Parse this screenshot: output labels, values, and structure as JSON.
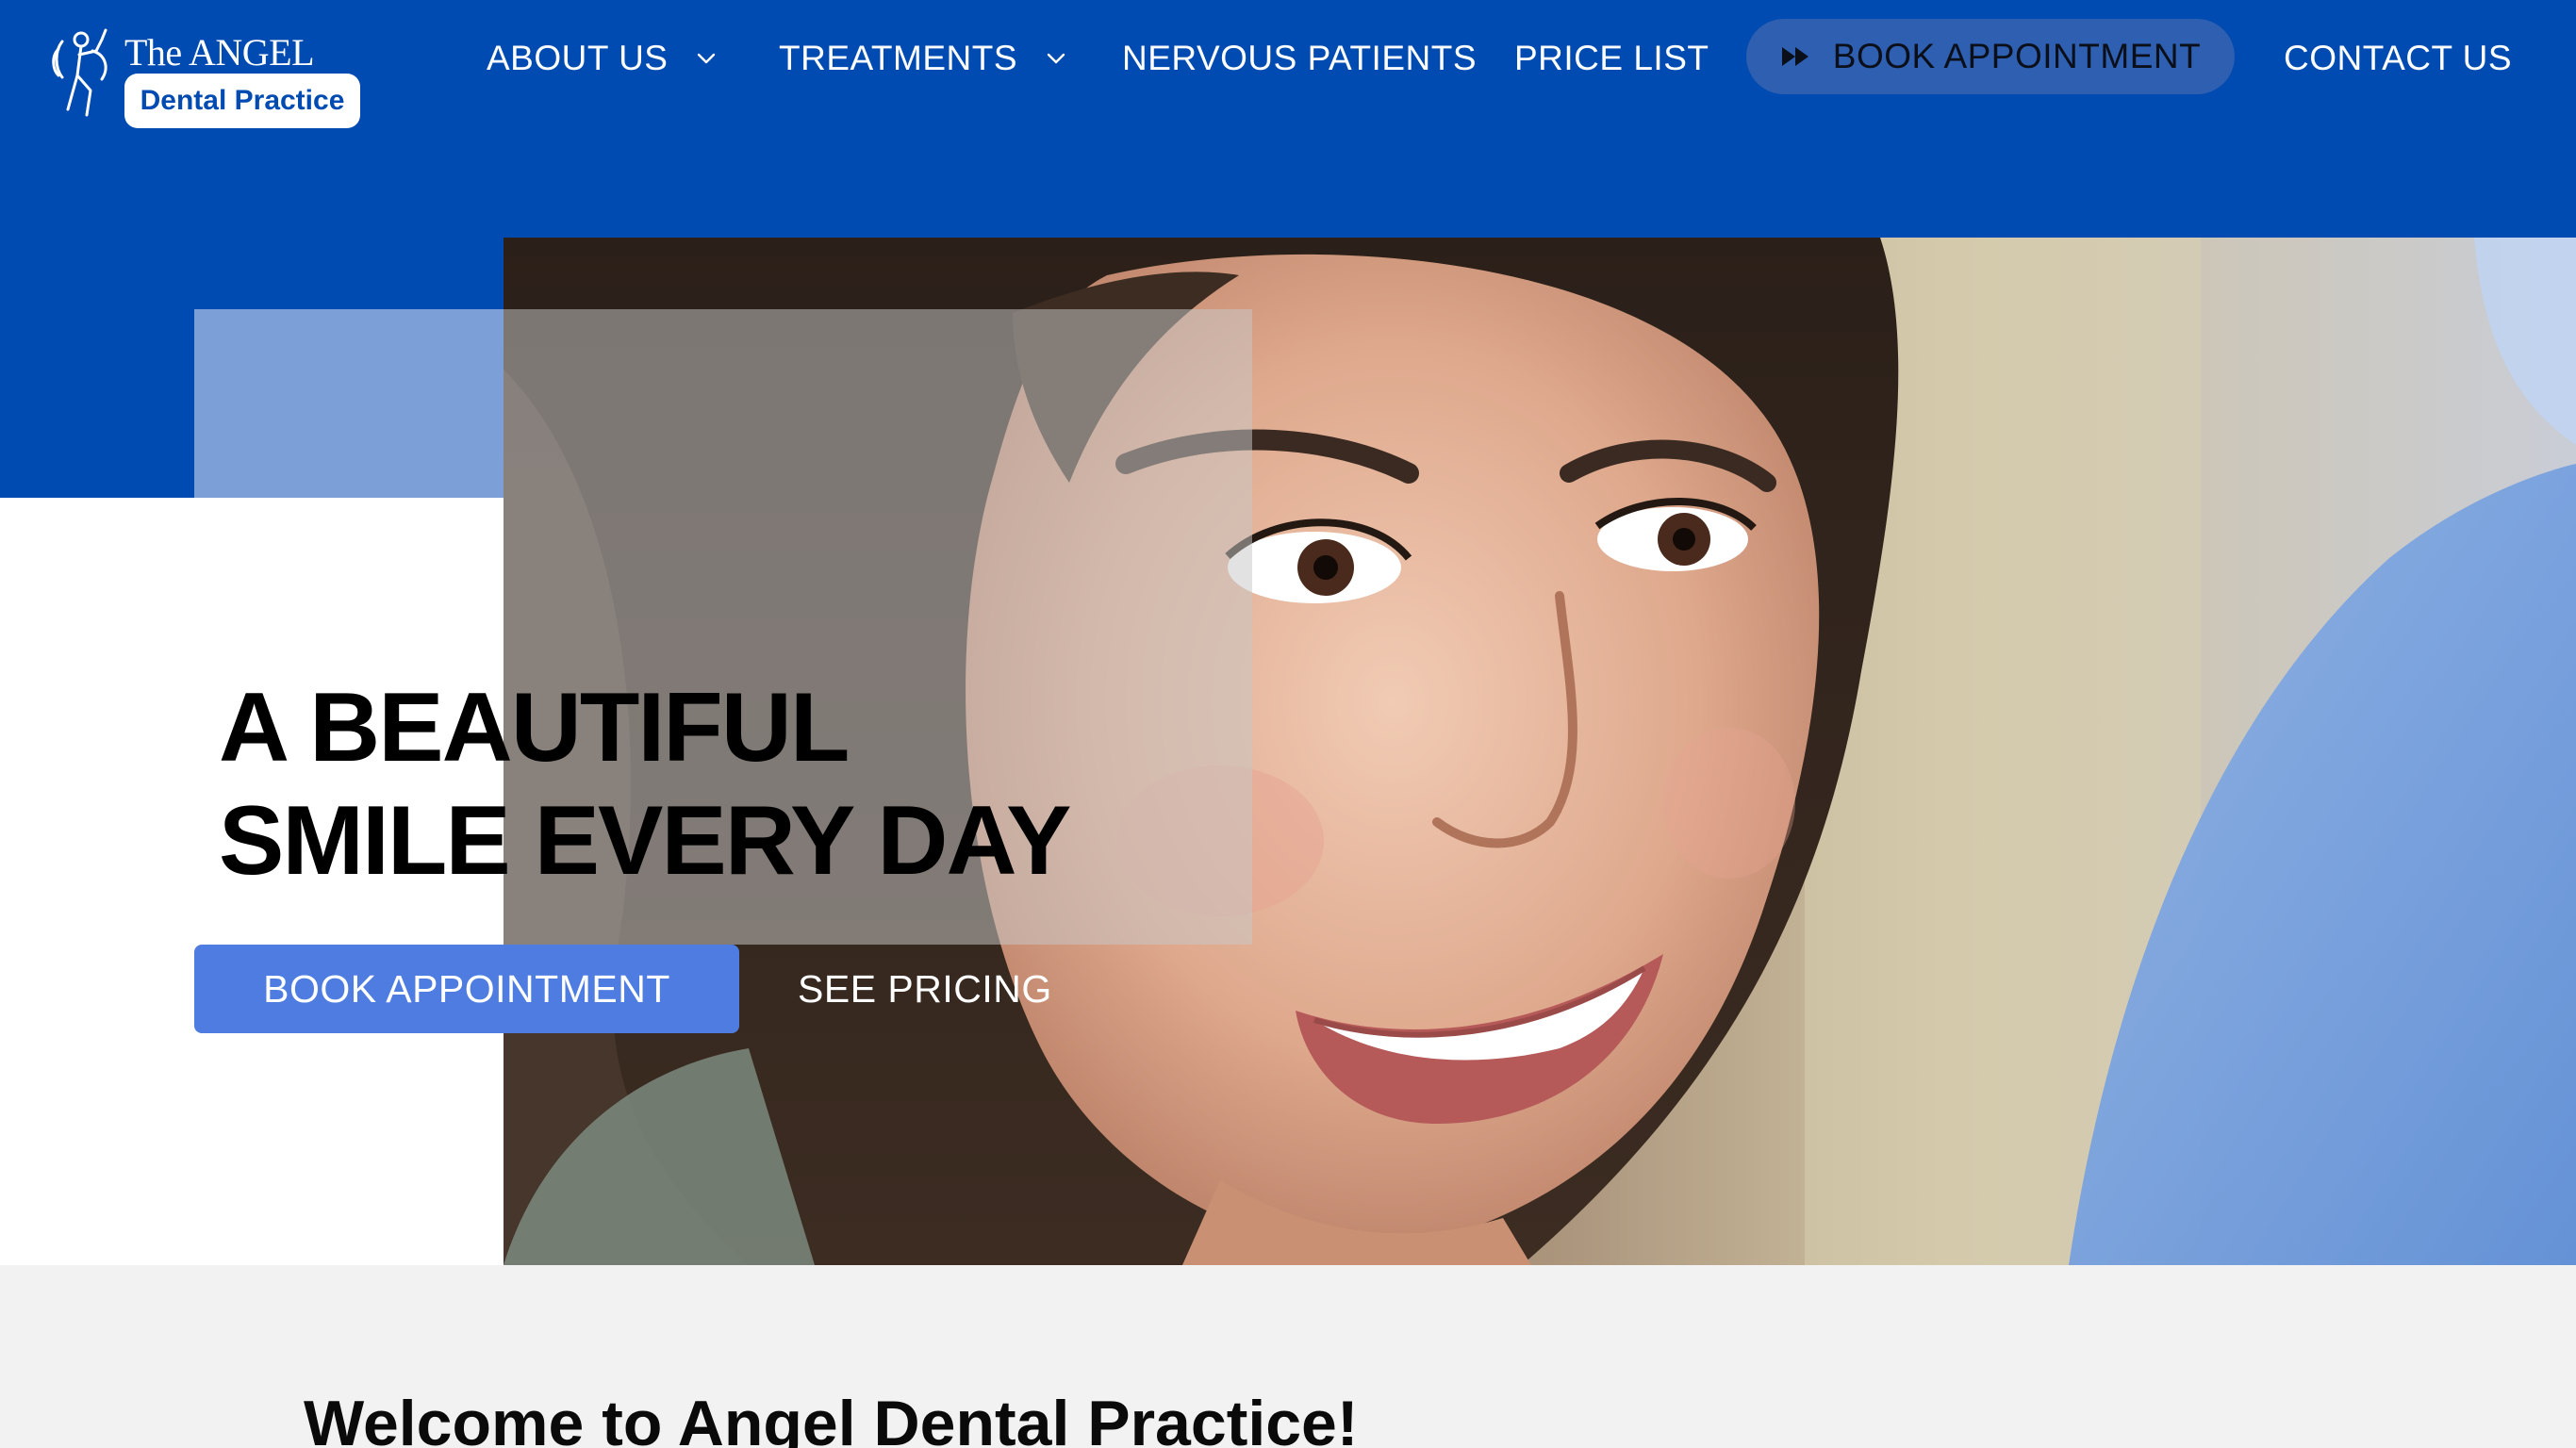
{
  "brand": {
    "name_line1": "The ANGEL",
    "name_line2": "Dental Practice",
    "icon": "angel-logo-icon"
  },
  "nav": {
    "items": [
      {
        "label": "ABOUT US",
        "has_dropdown": true
      },
      {
        "label": "TREATMENTS",
        "has_dropdown": true
      },
      {
        "label": "NERVOUS PATIENTS",
        "has_dropdown": false
      },
      {
        "label": "PRICE LIST",
        "has_dropdown": false
      }
    ],
    "book_label": "BOOK APPOINTMENT",
    "book_icon": "fast-forward-icon",
    "contact_label": "CONTACT US"
  },
  "hero": {
    "title_line1": "A BEAUTIFUL",
    "title_line2": "SMILE EVERY DAY",
    "primary_button": "BOOK APPOINTMENT",
    "secondary_button": "SEE PRICING",
    "image": "smiling-woman-dental-patient-photo"
  },
  "welcome": {
    "title": "Welcome to Angel Dental Practice!"
  },
  "colors": {
    "brand_blue": "#004bb1",
    "nav_button_blue": "#2e5fb0",
    "hero_button_blue": "#4f7ce0",
    "accent_light_blue": "#7c9fd8",
    "section_grey": "#f2f2f2"
  }
}
